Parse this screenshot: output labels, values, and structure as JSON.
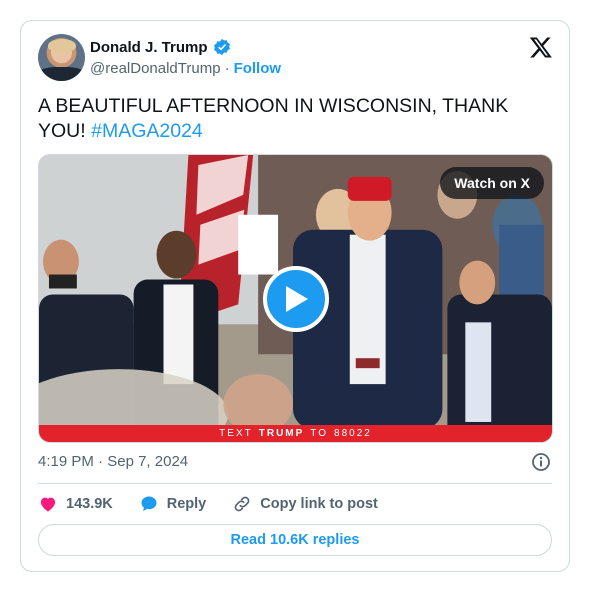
{
  "author": {
    "name": "Donald J. Trump",
    "handle": "@realDonaldTrump",
    "separator": "·",
    "follow_label": "Follow"
  },
  "tweet": {
    "text": "A BEAUTIFUL AFTERNOON IN WISCONSIN, THANK YOU!",
    "hashtag": "#MAGA2024"
  },
  "media": {
    "watch_label": "Watch on X",
    "banner_prefix": "TEXT",
    "banner_bold": "TRUMP",
    "banner_mid": "TO",
    "banner_number": "88022"
  },
  "meta": {
    "time": "4:19 PM",
    "dot": "·",
    "date": "Sep 7, 2024"
  },
  "actions": {
    "likes": "143.9K",
    "reply_label": "Reply",
    "copy_label": "Copy link to post"
  },
  "read_replies_label": "Read 10.6K replies",
  "colors": {
    "accent": "#1d9bf0",
    "like": "#f91880",
    "banner": "#e2232b"
  }
}
